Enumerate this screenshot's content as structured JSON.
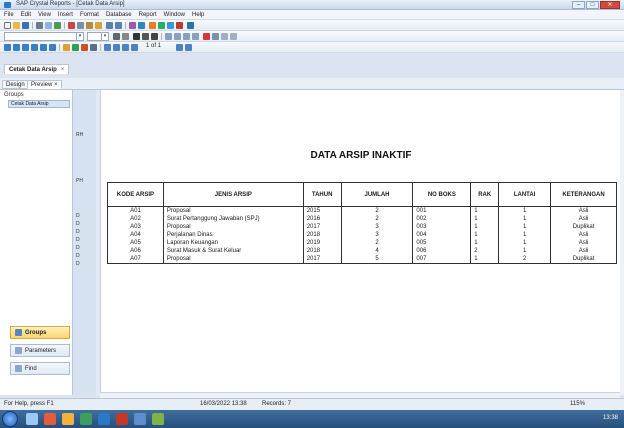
{
  "window": {
    "title": "SAP Crystal Reports - [Cetak Data Arsip]",
    "minimize": "–",
    "maximize": "□",
    "close": "✕"
  },
  "menu": [
    "File",
    "Edit",
    "View",
    "Insert",
    "Format",
    "Database",
    "Report",
    "Window",
    "Help"
  ],
  "toolbar": {
    "page_indicator": "1 of 1"
  },
  "document_tab": {
    "label": "Cetak Data Arsip",
    "close": "×"
  },
  "view_tabs": [
    "Design",
    "Preview ×"
  ],
  "group_tree": {
    "title": "Groups",
    "items": [
      "Cetak Data Arsip"
    ]
  },
  "panel_buttons": [
    "Groups",
    "Parameters",
    "Find"
  ],
  "section_labels": [
    "RH",
    "PH",
    "D",
    "D",
    "D",
    "D",
    "D",
    "D",
    "D"
  ],
  "report": {
    "title": "DATA ARSIP INAKTIF",
    "columns": [
      "KODE ARSIP",
      "JENIS ARSIP",
      "TAHUN",
      "JUMLAH",
      "NO BOKS",
      "RAK",
      "LANTAI",
      "KETERANGAN"
    ],
    "rows": [
      [
        "A01",
        "Proposal",
        "2015",
        "2",
        "001",
        "1",
        "1",
        "Asli"
      ],
      [
        "A02",
        "Surat Pertanggung Jawaban (SPJ)",
        "2016",
        "2",
        "002",
        "1",
        "1",
        "Asli"
      ],
      [
        "A03",
        "Proposal",
        "2017",
        "3",
        "003",
        "1",
        "1",
        "Duplikat"
      ],
      [
        "A04",
        "Perjalanan Dinas",
        "2018",
        "3",
        "004",
        "1",
        "1",
        "Asli"
      ],
      [
        "A05",
        "Laporan Keuangan",
        "2019",
        "2",
        "005",
        "1",
        "1",
        "Asli"
      ],
      [
        "A06",
        "Surat Masuk & Surat Keluar",
        "2018",
        "4",
        "006",
        "2",
        "1",
        "Asli"
      ],
      [
        "A07",
        "Proposal",
        "2017",
        "5",
        "007",
        "1",
        "2",
        "Duplikat"
      ]
    ]
  },
  "status": {
    "help": "For Help, press F1",
    "datetime": "16/03/2022 13:38",
    "records": "Records: 7",
    "zoom": "115%"
  },
  "taskbar": {
    "clock": "13:38"
  },
  "colors": {
    "accent": "#2a78c8",
    "selected_button": "#ffd36b",
    "taskbar": "#274f7c"
  }
}
